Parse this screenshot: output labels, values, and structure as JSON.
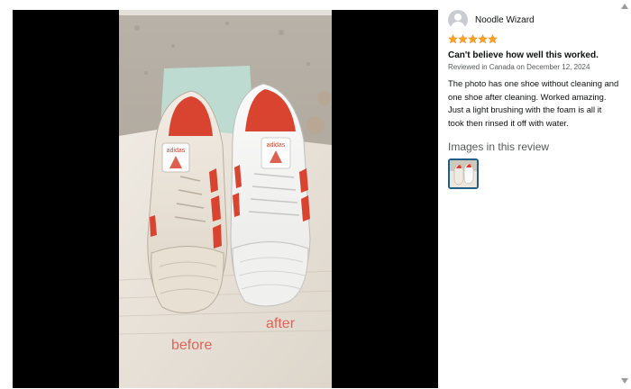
{
  "review": {
    "reviewer_name": "Noodle Wizard",
    "rating": 5,
    "rating_max": 5,
    "title": "Can't believe how well this worked.",
    "meta": "Reviewed in Canada on December 12, 2024",
    "body": "The photo has one shoe without cleaning and one shoe after cleaning. Worked amazing. Just a light brushing with the foam is all it took then rinsed it off with water.",
    "images_heading": "Images in this review"
  },
  "photo": {
    "label_before": "before",
    "label_after": "after",
    "brand_text": "adidas"
  },
  "colors": {
    "star": "#ffa41c",
    "thumb_border": "#1f5e86",
    "annotation": "#e0645a",
    "shoe_stripe": "#d8442f"
  },
  "icons": [
    "avatar-icon",
    "star-icon",
    "scroll-up-icon",
    "scroll-down-icon"
  ]
}
